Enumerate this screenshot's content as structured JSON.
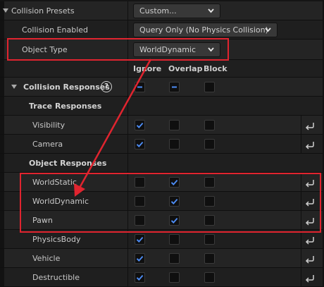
{
  "colors": {
    "accent": "#4d8cf5",
    "highlight": "#e0242f"
  },
  "collision_presets": {
    "label": "Collision Presets",
    "value": "Custom..."
  },
  "collision_enabled": {
    "label": "Collision Enabled",
    "value": "Query Only (No Physics Collision)"
  },
  "object_type": {
    "label": "Object Type",
    "value": "WorldDynamic"
  },
  "columns": {
    "ignore": "Ignore",
    "overlap": "Overlap",
    "block": "Block"
  },
  "collision_responses": {
    "label": "Collision Responses",
    "help": "?"
  },
  "trace_responses": {
    "label": "Trace Responses",
    "items": [
      {
        "label": "Visibility",
        "ignore": true,
        "overlap": false,
        "block": false
      },
      {
        "label": "Camera",
        "ignore": true,
        "overlap": false,
        "block": false
      }
    ]
  },
  "object_responses": {
    "label": "Object Responses",
    "items": [
      {
        "label": "WorldStatic",
        "ignore": false,
        "overlap": true,
        "block": false
      },
      {
        "label": "WorldDynamic",
        "ignore": false,
        "overlap": true,
        "block": false
      },
      {
        "label": "Pawn",
        "ignore": false,
        "overlap": true,
        "block": false
      },
      {
        "label": "PhysicsBody",
        "ignore": true,
        "overlap": false,
        "block": false
      },
      {
        "label": "Vehicle",
        "ignore": true,
        "overlap": false,
        "block": false
      },
      {
        "label": "Destructible",
        "ignore": true,
        "overlap": false,
        "block": false
      }
    ]
  }
}
